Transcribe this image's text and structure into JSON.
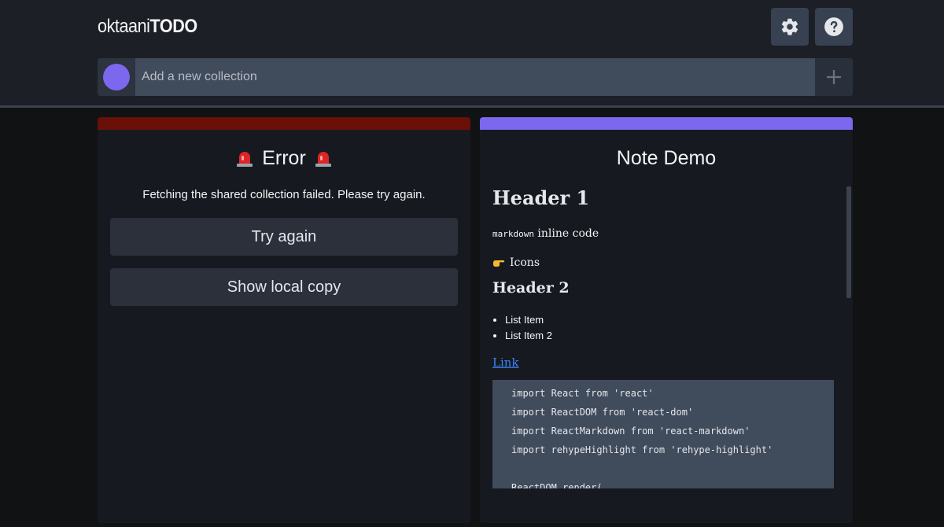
{
  "app": {
    "logo_light": "oktaani",
    "logo_bold": "TODO"
  },
  "toolbar": {
    "settings_icon": "gear-icon",
    "help_icon": "question-circle-icon"
  },
  "add_collection": {
    "placeholder": "Add a new collection",
    "color": "#7b68ee",
    "add_icon": "plus-icon"
  },
  "error_card": {
    "title": "Error",
    "icon": "police-light-emoji",
    "message": "Fetching the shared collection failed. Please try again.",
    "try_again_label": "Try again",
    "show_local_label": "Show local copy",
    "accent": "#6b0f09"
  },
  "note_card": {
    "title": "Note Demo",
    "accent": "#7b68ee",
    "h1": "Header 1",
    "inline_code": "markdown",
    "inline_text": " inline code",
    "icons_text": "Icons",
    "icons_emoji": "pointing-hand-emoji",
    "h2": "Header 2",
    "list_items": [
      "List Item",
      "List Item 2"
    ],
    "link_text": "Link",
    "code_lines": [
      "import React from 'react'",
      "import ReactDOM from 'react-dom'",
      "import ReactMarkdown from 'react-markdown'",
      "import rehypeHighlight from 'rehype-highlight'",
      "",
      "ReactDOM.render("
    ]
  }
}
